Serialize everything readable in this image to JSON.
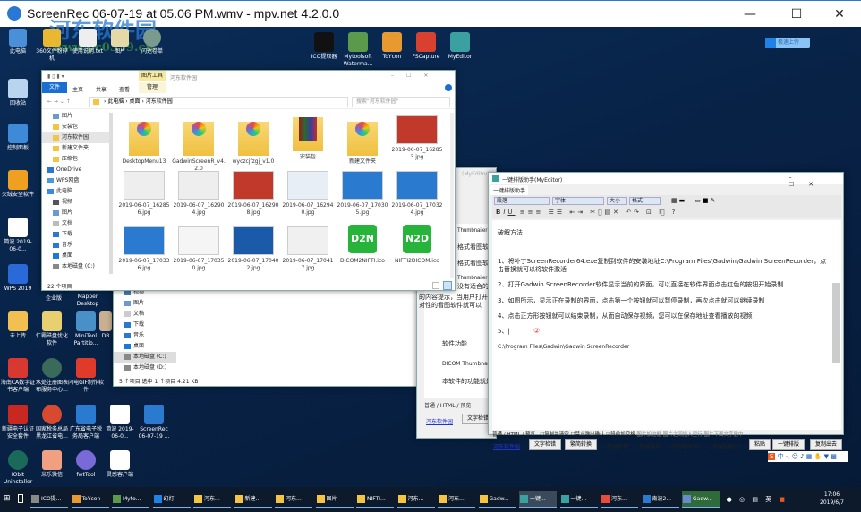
{
  "window": {
    "title": "ScreenRec 06-07-19 at 05.06 PM.wmv - mpv.net 4.2.0.0",
    "minimize": "—",
    "maximize": "☐",
    "close": "✕"
  },
  "watermark": {
    "name": "河东软件园",
    "url": "www.pc0359.cn"
  },
  "desktop": {
    "top_icons": [
      "此电脑",
      "360文件粉碎机",
      "使用说明.txt",
      "图片",
      "闪达卷单"
    ],
    "top_right_icons": [
      "ICO提取器",
      "Mytoolsoft Waterma...",
      "ToYcon",
      "FSCapture",
      "MyEditor"
    ],
    "left_icons": [
      "回收站",
      "控制面板",
      "火绒安全软件",
      "简波 2019-06-0...",
      "WPS 2019"
    ],
    "grid_icons": [
      [
        "未上传",
        "仁霸磁盘优化软件",
        "MiniTool Partitio...",
        "DB"
      ],
      [
        "海南CA数字证书客户端",
        "水处注册图表布服务中心...",
        "闪电GIF制作软件"
      ],
      [
        "新疆电子认证安全套件",
        "国家税务总局黑龙江省电...",
        "广东省电子税务局客户端",
        "简波 2019-06-0...",
        "ScreenRec 06-07-19 ..."
      ],
      [
        "IObit Uninstaller",
        "米乐微信",
        "fwtTool",
        "灵感客户端"
      ]
    ],
    "partial_labels": [
      "企业版",
      "Mapper Desktop",
      "ScreenRec..."
    ],
    "upload_button": "极速上传"
  },
  "explorer": {
    "quick_access": [
      "文件",
      "图片工具",
      "河东软件园"
    ],
    "ribbon_tabs": [
      "文件",
      "主页",
      "共享",
      "查看",
      "管理"
    ],
    "breadcrumb": [
      "此电脑",
      "桌面",
      "河东软件园"
    ],
    "search_placeholder": "搜索\"河东软件园\"",
    "nav": [
      "图片",
      "安装包",
      "河东软件园",
      "新建文件夹",
      "压缩包",
      "OneDrive",
      "WPS网盘",
      "此电脑",
      "视频",
      "图片",
      "文档",
      "下载",
      "音乐",
      "桌面",
      "本地磁盘 (C:)"
    ],
    "files": [
      "DesktopMenu13",
      "GadwinScreenR_v4.2.0",
      "wyczcjfzgj_v1.0",
      "安装包",
      "新建文件夹",
      "2019-06-07_162853.jpg",
      "2019-06-07_162856.jpg",
      "2019-06-07_162904.jpg",
      "2019-06-07_162908.jpg",
      "2019-06-07_162940.jpg",
      "2019-06-07_170305.jpg",
      "2019-06-07_170324.jpg",
      "2019-06-07_170336.jpg",
      "2019-06-07_170350.jpg",
      "2019-06-07_170402.jpg",
      "2019-06-07_170417.jpg",
      "DICOM2NIFTI.ico",
      "NIFTI2DICOM.ico"
    ],
    "status": "22 个项目"
  },
  "explorer2": {
    "nav": [
      "视频",
      "图片",
      "文档",
      "下载",
      "音乐",
      "桌面",
      "本地磁盘 (C:)",
      "本地磁盘 (D:)"
    ],
    "status": "5 个项目    选中 1 个项目  4.21 KB"
  },
  "editor_back": {
    "title": "(MyEditor)",
    "lines": [
      "Thumbnailer",
      "格式看图软件",
      "格式看图软件",
      "Thumbnailer",
      "没有适合的",
      "的内容提示，当用户打开",
      "对性的看图软件就可以",
      "软件功能",
      "DICOM Thumbnailer",
      "本软件的功能就是"
    ],
    "tabs": [
      "普通",
      "HTML",
      "预览"
    ],
    "link": "河东软件园",
    "button": "文字检错"
  },
  "editor": {
    "title": "一键排版助手(MyEditor)",
    "tab": "一键排版助手",
    "selects": [
      "段落",
      "字体",
      "大小",
      "格式"
    ],
    "lines": [
      "破解方法",
      "1、将补丁ScreenRecorder64.exe复制到软件的安装地址C:\\Program Files\\Gadwin\\Gadwin ScreenRecorder，点击替换就可以将软件激活",
      "2、打开Gadwin ScreenRecorder软件显示当前的界面，可以直接在软件界面点击红色的按钮开始录制",
      "3、如图所示，显示正在录制的界面，点击第一个按钮就可以暂停录制，再次点击就可以继续录制",
      "4、点击正方形按钮就可以结束录制，从而自动保存视频，您可以在保存地址查看播放的视频",
      "5、|",
      "C:\\Program Files\\Gadwin\\Gadwin ScreenRecorder"
    ],
    "marker": "②",
    "bottom_tabs": [
      "普通",
      "HTML",
      "预览"
    ],
    "checkboxes": [
      {
        "label": "复制并清空",
        "checked": false
      },
      {
        "label": "禁止弹出确认",
        "checked": false
      },
      {
        "label": "段前加空格",
        "checked": true
      }
    ],
    "disabled_options": [
      "图片加边框",
      "图片之间插入空行",
      "图片下面文字居中"
    ],
    "link": "河东软件园",
    "buttons": [
      "文字检错",
      "繁简转换",
      "粘贴",
      "一键排版",
      "复制出去"
    ],
    "radios": [
      "保留表格",
      "保留链接",
      "保留粗体(B)",
      "保留粗体(S)"
    ]
  },
  "taskbar": {
    "items": [
      "ICO提...",
      "ToYcon",
      "Myto...",
      "幻灯",
      "河东...",
      "新建...",
      "河东...",
      "图片",
      "NIFTI...",
      "河东...",
      "河东...",
      "Gadw...",
      "一键...",
      "一键...",
      "河东...",
      "南波2...",
      "Gadw..."
    ],
    "ime": "中",
    "lang": "英",
    "time": "17:06",
    "date": "2019/6/7"
  }
}
